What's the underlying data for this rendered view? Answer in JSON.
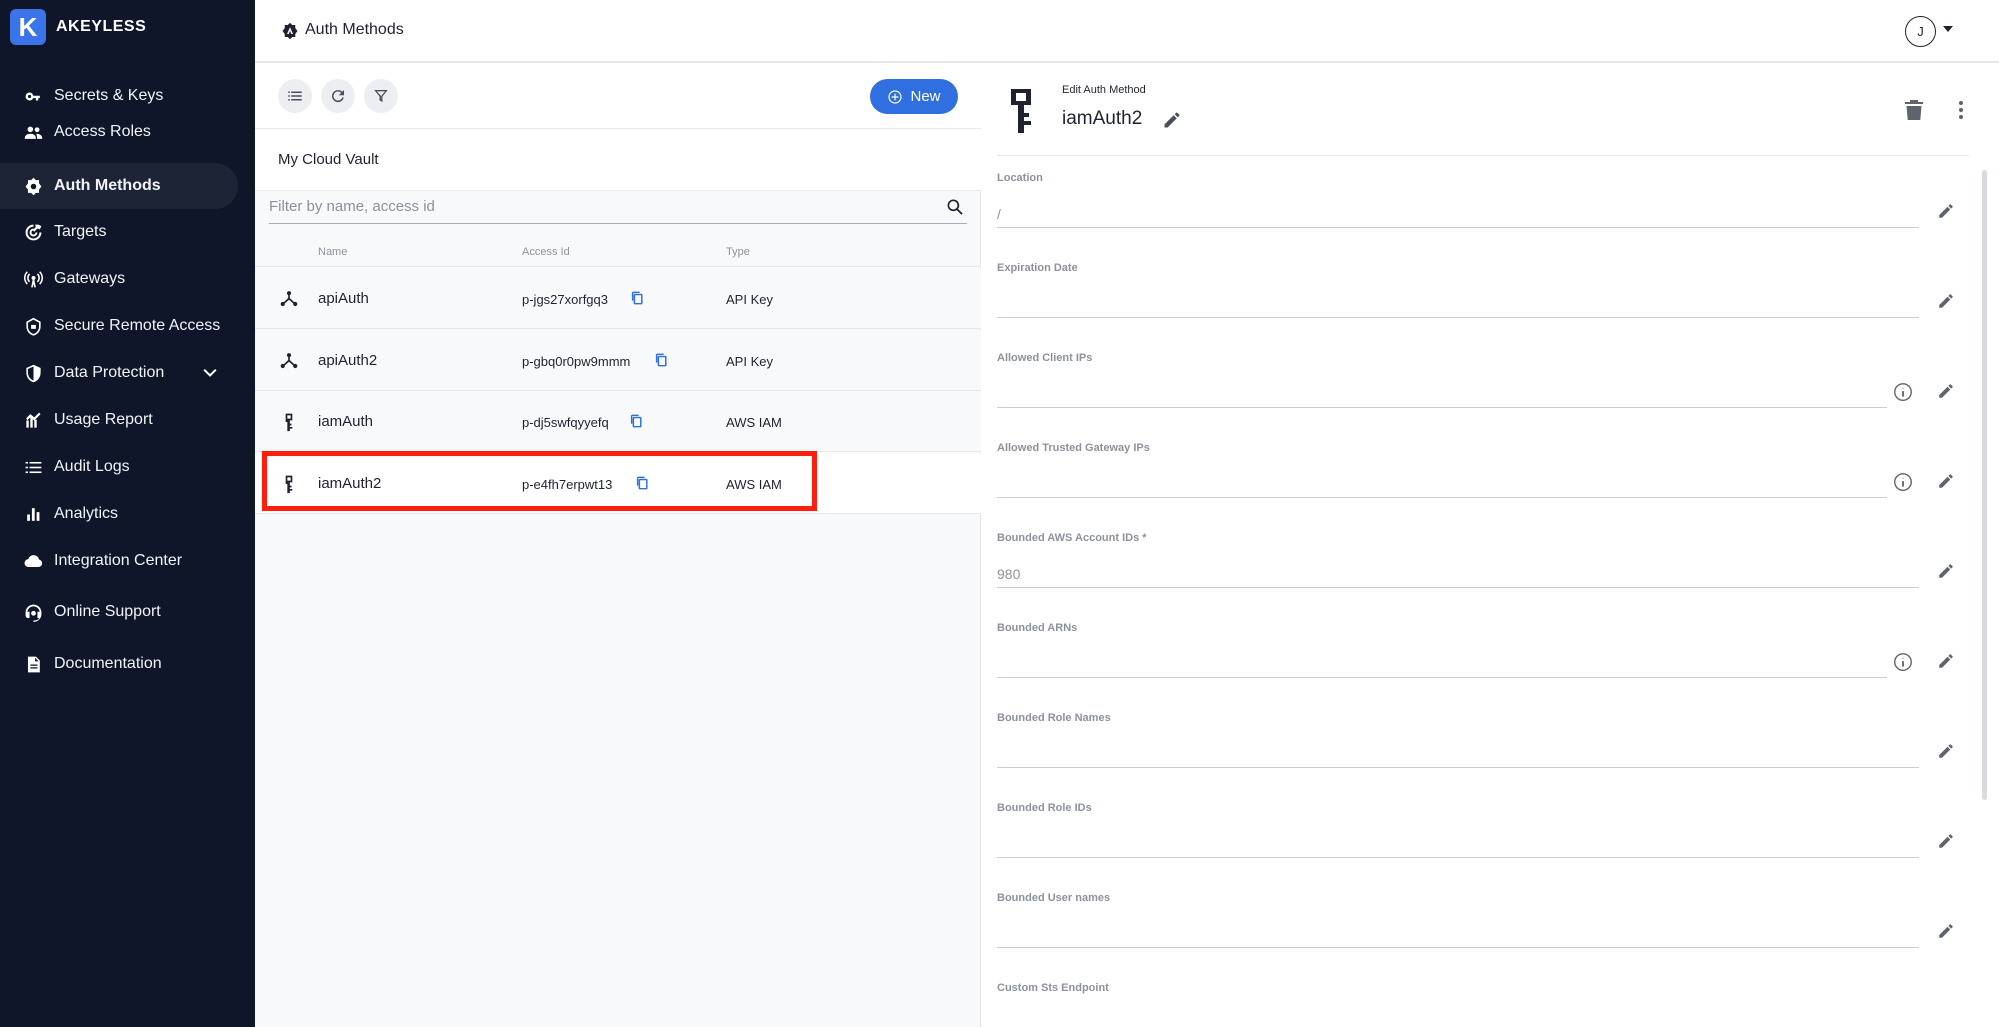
{
  "brand": {
    "logo_letter": "K",
    "name": "AKEYLESS"
  },
  "sidebar": {
    "items": [
      {
        "label": "Secrets & Keys",
        "icon": "key-icon"
      },
      {
        "label": "Access Roles",
        "icon": "people-icon"
      },
      {
        "label": "Auth Methods",
        "icon": "gear-shield-icon",
        "active": true
      },
      {
        "label": "Targets",
        "icon": "target-icon"
      },
      {
        "label": "Gateways",
        "icon": "gateway-icon"
      },
      {
        "label": "Secure Remote Access",
        "icon": "shield-lock-icon"
      },
      {
        "label": "Data Protection",
        "icon": "shield-icon",
        "expandable": true
      },
      {
        "label": "Usage Report",
        "icon": "usage-chart-icon"
      },
      {
        "label": "Audit Logs",
        "icon": "list-icon"
      },
      {
        "label": "Analytics",
        "icon": "bar-chart-icon"
      },
      {
        "label": "Integration Center",
        "icon": "cloud-icon"
      },
      {
        "label": "Online Support",
        "icon": "support-icon"
      },
      {
        "label": "Documentation",
        "icon": "document-icon"
      }
    ]
  },
  "topbar": {
    "title": "Auth Methods",
    "avatar_initial": "J"
  },
  "list": {
    "new_label": "New",
    "vault_name": "My Cloud Vault",
    "filter_placeholder": "Filter by name, access id",
    "columns": {
      "name": "Name",
      "access_id": "Access Id",
      "type": "Type"
    },
    "rows": [
      {
        "name": "apiAuth",
        "access_id": "p-jgs27xorfgq3",
        "type": "API Key",
        "icon": "api-key-icon"
      },
      {
        "name": "apiAuth2",
        "access_id": "p-gbq0r0pw9mmm",
        "type": "API Key",
        "icon": "api-key-icon"
      },
      {
        "name": "iamAuth",
        "access_id": "p-dj5swfqyyefq",
        "type": "AWS IAM",
        "icon": "aws-iam-key-icon"
      },
      {
        "name": "iamAuth2",
        "access_id": "p-e4fh7erpwt13",
        "type": "AWS IAM",
        "icon": "aws-iam-key-icon",
        "selected": true
      }
    ]
  },
  "detail": {
    "caption": "Edit Auth Method",
    "title": "iamAuth2",
    "fields": [
      {
        "label": "Location",
        "value": "/",
        "info": false
      },
      {
        "label": "Expiration Date",
        "value": "",
        "info": false
      },
      {
        "label": "Allowed Client IPs",
        "value": "",
        "info": true
      },
      {
        "label": "Allowed Trusted Gateway IPs",
        "value": "",
        "info": true
      },
      {
        "label": "Bounded AWS Account IDs *",
        "value": "980",
        "info": false
      },
      {
        "label": "Bounded ARNs",
        "value": "",
        "info": true
      },
      {
        "label": "Bounded Role Names",
        "value": "",
        "info": false
      },
      {
        "label": "Bounded Role IDs",
        "value": "",
        "info": false
      },
      {
        "label": "Bounded User names",
        "value": "",
        "info": false
      },
      {
        "label": "Custom Sts Endpoint",
        "value": "",
        "info": false
      }
    ]
  },
  "colors": {
    "sidebar_bg": "#0f1629",
    "accent": "#2f6fdf",
    "highlight": "#ff1d0b"
  }
}
